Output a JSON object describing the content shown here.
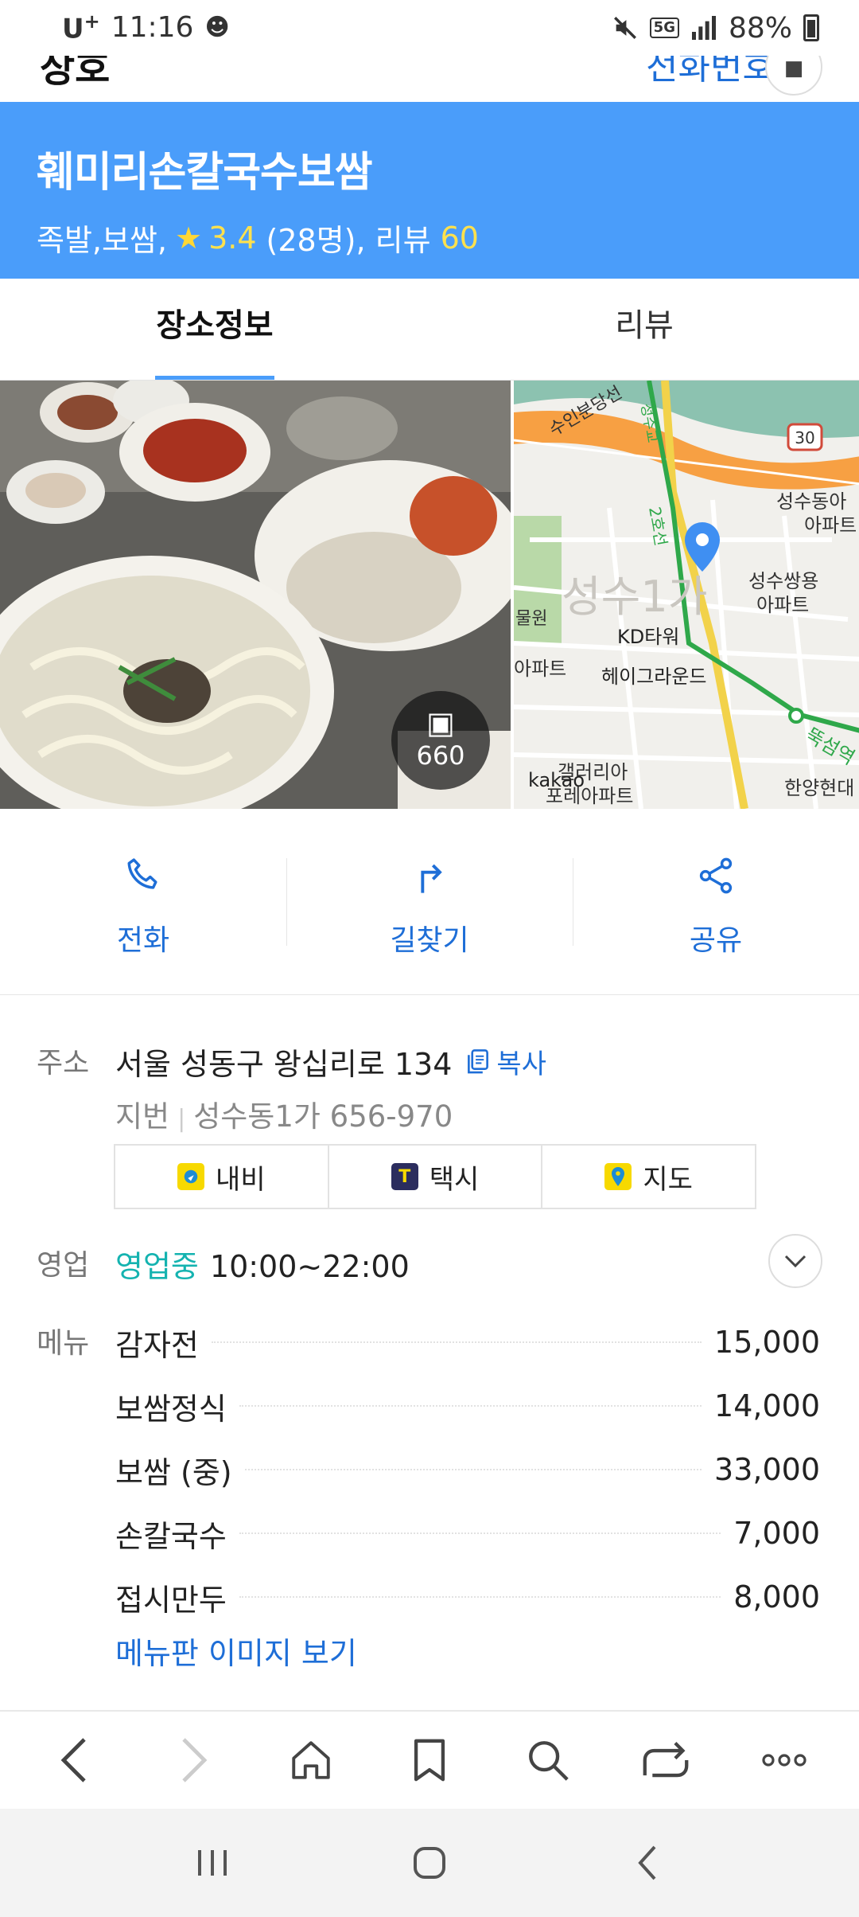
{
  "status_bar": {
    "carrier": "U",
    "carrier_sup": "+",
    "time": "11:16",
    "network": "5G",
    "battery": "88%"
  },
  "top_bar": {
    "cut_title": "상호",
    "cut_link": "전화번호"
  },
  "place": {
    "name": "훼미리손칼국수보쌈",
    "category": "족발,보쌈,",
    "rating": "3.4",
    "rating_count": "(28명), 리뷰",
    "review_count": "60"
  },
  "tabs": [
    {
      "label": "장소정보",
      "active": true
    },
    {
      "label": "리뷰",
      "active": false
    }
  ],
  "photo": {
    "count": "660"
  },
  "map": {
    "labels": {
      "river_road": "수인분당선",
      "line2": "2호선",
      "route30": "30",
      "apt1": "성수동아",
      "apt1b": "아파트",
      "apt2": "성수쌍용",
      "apt2b": "아파트",
      "kd": "KD타워",
      "heigraund": "헤이그라운드",
      "apt3": "아파트",
      "water": "물원",
      "district": "성수1가",
      "station": "뚝섬역",
      "galleria": "갤러리아",
      "forest": "포레아파트",
      "hanyang": "한양현대",
      "kakao": "kakao",
      "seoul": "성수교"
    }
  },
  "actions": [
    {
      "label": "전화",
      "icon": "phone-icon"
    },
    {
      "label": "길찾기",
      "icon": "route-icon"
    },
    {
      "label": "공유",
      "icon": "share-icon"
    }
  ],
  "info": {
    "address_label": "주소",
    "address": "서울 성동구 왕십리로 134",
    "copy_label": "복사",
    "jibun_label": "지번",
    "jibun": "성수동1가 656-970",
    "links": [
      {
        "label": "내비",
        "icon": "navi-icon",
        "color": "#f7d900"
      },
      {
        "label": "택시",
        "icon": "taxi-icon",
        "color": "#2b2d5e"
      },
      {
        "label": "지도",
        "icon": "map-pin-icon",
        "color": "#f7d900"
      }
    ],
    "hours_label": "영업",
    "open_status": "영업중",
    "hours": "10:00~22:00",
    "menu_label": "메뉴",
    "menu": [
      {
        "name": "감자전",
        "price": "15,000"
      },
      {
        "name": "보쌈정식",
        "price": "14,000"
      },
      {
        "name": "보쌈 (중)",
        "price": "33,000"
      },
      {
        "name": "손칼국수",
        "price": "7,000"
      },
      {
        "name": "접시만두",
        "price": "8,000"
      }
    ],
    "menu_more": "메뉴판 이미지 보기"
  },
  "colors": {
    "header_blue": "#4a9dfa",
    "link_blue": "#1e6ed7",
    "open_teal": "#14b3b0",
    "highlight_yellow": "#ffe14d"
  }
}
